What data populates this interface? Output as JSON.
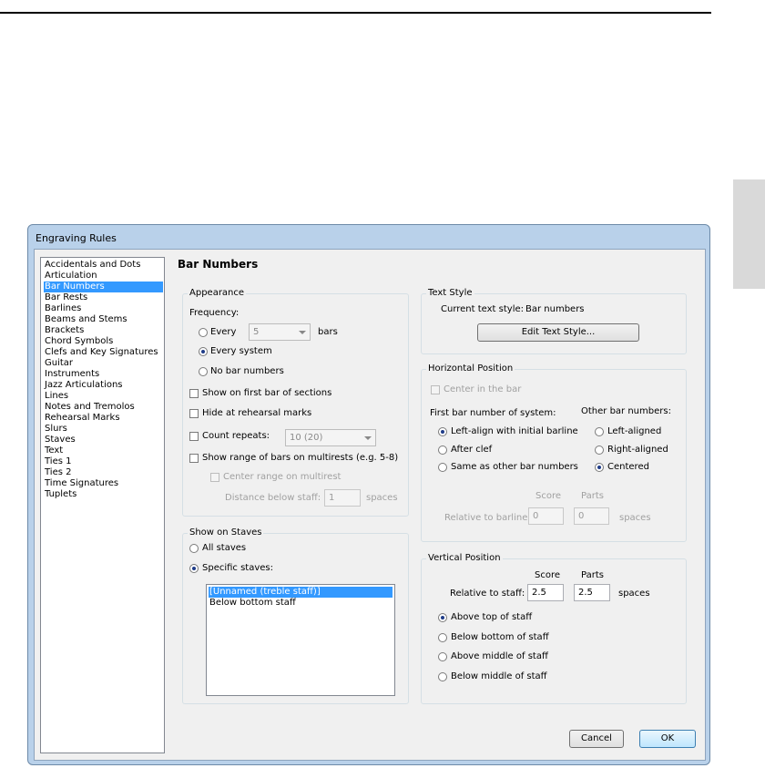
{
  "dialog": {
    "title": "Engraving Rules",
    "categories": [
      "Accidentals and Dots",
      "Articulation",
      "Bar Numbers",
      "Bar Rests",
      "Barlines",
      "Beams and Stems",
      "Brackets",
      "Chord Symbols",
      "Clefs and Key Signatures",
      "Guitar",
      "Instruments",
      "Jazz Articulations",
      "Lines",
      "Notes and Tremolos",
      "Rehearsal Marks",
      "Slurs",
      "Staves",
      "Text",
      "Ties 1",
      "Ties 2",
      "Time Signatures",
      "Tuplets"
    ],
    "selected_category": "Bar Numbers",
    "heading": "Bar Numbers"
  },
  "appearance": {
    "group_label": "Appearance",
    "frequency_label": "Frequency:",
    "every_label": "Every",
    "every_value": "5",
    "bars_label": "bars",
    "every_system_label": "Every system",
    "no_bar_numbers_label": "No bar numbers",
    "selected_frequency": "Every system",
    "show_first_bar_label": "Show on first bar of sections",
    "hide_rehearsal_label": "Hide at rehearsal marks",
    "count_repeats_label": "Count repeats:",
    "count_repeats_value": "10 (20)",
    "show_range_label": "Show range of bars on multirests (e.g. 5-8)",
    "center_range_label": "Center range on multirest",
    "distance_label": "Distance below staff:",
    "distance_value": "1",
    "spaces_label": "spaces"
  },
  "show_on_staves": {
    "group_label": "Show on Staves",
    "all_staves_label": "All staves",
    "specific_staves_label": "Specific staves:",
    "selected": "Specific staves",
    "staves": [
      "[Unnamed (treble staff)]",
      "Below bottom staff"
    ],
    "selected_stave": "[Unnamed (treble staff)]"
  },
  "text_style": {
    "group_label": "Text Style",
    "current_label": "Current text style:",
    "current_value": "Bar numbers",
    "edit_button": "Edit Text Style..."
  },
  "horizontal_position": {
    "group_label": "Horizontal Position",
    "center_in_bar_label": "Center in the bar",
    "first_bar_label": "First bar number of system:",
    "first_bar_options": [
      "Left-align with initial barline",
      "After clef",
      "Same as other bar numbers"
    ],
    "first_bar_selected": "Left-align with initial barline",
    "other_label": "Other bar numbers:",
    "other_options": [
      "Left-aligned",
      "Right-aligned",
      "Centered"
    ],
    "other_selected": "Centered",
    "score_label": "Score",
    "parts_label": "Parts",
    "relative_label": "Relative to barline:",
    "score_value": "0",
    "parts_value": "0",
    "spaces_label": "spaces"
  },
  "vertical_position": {
    "group_label": "Vertical Position",
    "score_label": "Score",
    "parts_label": "Parts",
    "relative_label": "Relative to staff:",
    "score_value": "2.5",
    "parts_value": "2.5",
    "spaces_label": "spaces",
    "options": [
      "Above top of staff",
      "Below bottom of staff",
      "Above middle of staff",
      "Below middle of staff"
    ],
    "selected": "Above top of staff"
  },
  "buttons": {
    "cancel": "Cancel",
    "ok": "OK"
  }
}
